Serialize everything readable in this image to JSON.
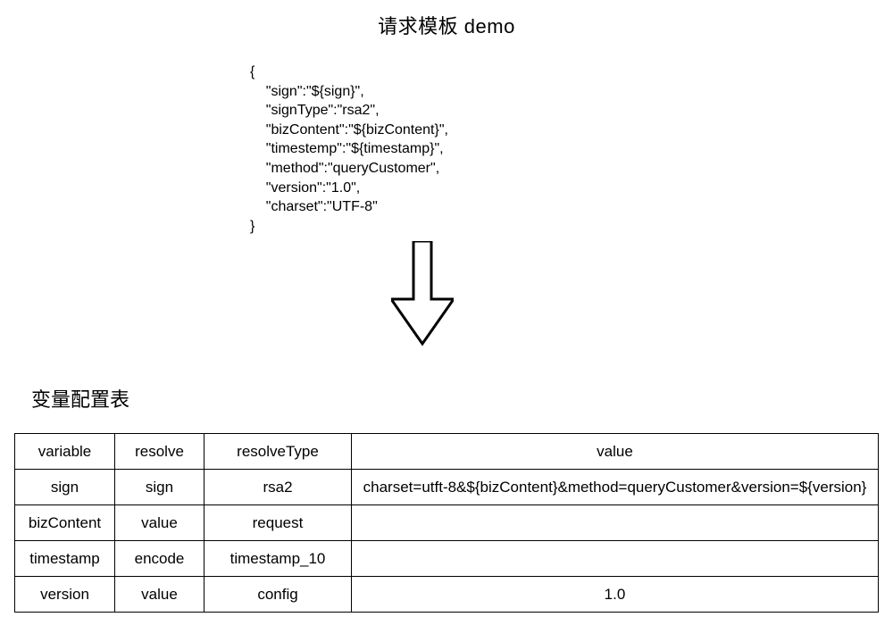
{
  "title": "请求模板 demo",
  "code": "{\n    \"sign\":\"${sign}\",\n    \"signType\":\"rsa2\",\n    \"bizContent\":\"${bizContent}\",\n    \"timestemp\":\"${timestamp}\",\n    \"method\":\"queryCustomer\",\n    \"version\":\"1.0\",\n    \"charset\":\"UTF-8\"\n}",
  "section_label": "变量配置表",
  "table": {
    "headers": [
      "variable",
      "resolve",
      "resolveType",
      "value"
    ],
    "rows": [
      {
        "variable": "sign",
        "resolve": "sign",
        "resolveType": "rsa2",
        "value": "charset=utft-8&${bizContent}&method=queryCustomer&version=${version}"
      },
      {
        "variable": "bizContent",
        "resolve": "value",
        "resolveType": "request",
        "value": ""
      },
      {
        "variable": "timestamp",
        "resolve": "encode",
        "resolveType": "timestamp_10",
        "value": ""
      },
      {
        "variable": "version",
        "resolve": "value",
        "resolveType": "config",
        "value": "1.0"
      }
    ]
  }
}
